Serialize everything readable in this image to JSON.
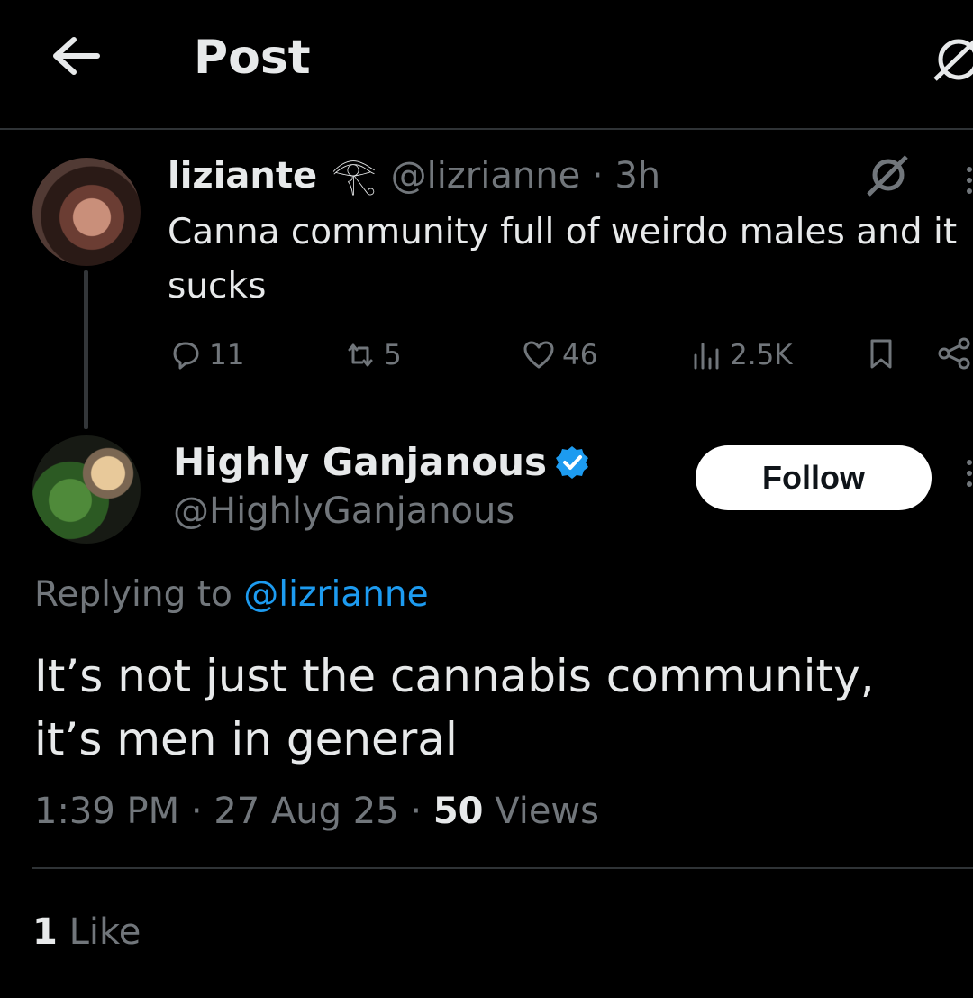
{
  "header": {
    "title": "Post"
  },
  "parent_post": {
    "display_name": "liziante",
    "name_symbol": "𓂀",
    "handle": "@lizrianne",
    "separator": "·",
    "time": "3h",
    "text": "Canna community full of weirdo males and it sucks",
    "metrics": {
      "replies": "11",
      "reposts": "5",
      "likes": "46",
      "views": "2.5K"
    }
  },
  "reply_post": {
    "display_name": "Highly Ganjanous",
    "handle": "@HighlyGanjanous",
    "follow_label": "Follow",
    "replying_prefix": "Replying to",
    "replying_handle": "@lizrianne",
    "text": "It’s not just the cannabis community, it’s men in general",
    "time": "1:39 PM",
    "sep1": "·",
    "date": "27 Aug 25",
    "sep2": "·",
    "views_count": "50",
    "views_label": "Views",
    "likes_count": "1",
    "likes_label": "Like"
  },
  "colors": {
    "accent": "#1d9bf0",
    "muted": "#71767b",
    "text": "#e7e9ea",
    "background": "#000000"
  }
}
